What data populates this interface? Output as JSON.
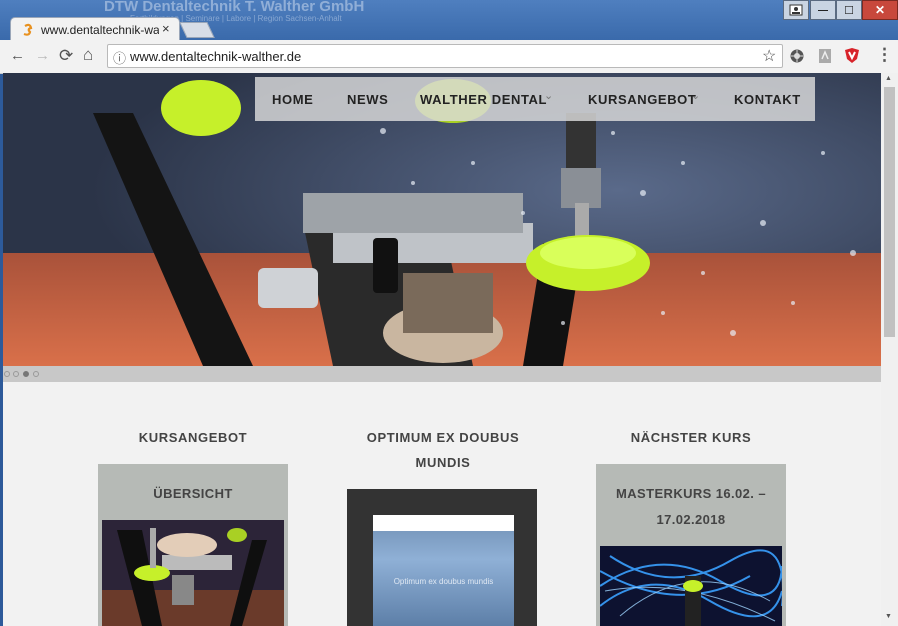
{
  "background_window": {
    "title": "DTW Dentaltechnik T. Walther GmbH",
    "subtitle": "Fortbildungen | Seminare | Labore | Region Sachsen-Anhalt"
  },
  "window_controls": {
    "minimize": "—",
    "maximize": "☐",
    "close": "✕"
  },
  "tab": {
    "title": "www.dentaltechnik-walth",
    "close": "×"
  },
  "toolbar": {
    "back": "←",
    "forward": "→",
    "reload": "⟳",
    "home": "⌂",
    "star": "☆",
    "menu": "⋮"
  },
  "omnibox": {
    "url": "www.dentaltechnik-walther.de",
    "info": "ⓘ"
  },
  "nav": {
    "items": [
      "HOME",
      "NEWS",
      "WALTHER DENTAL",
      "KURSANGEBOT",
      "KONTAKT"
    ],
    "dropdown_marker": "⌄"
  },
  "slider": {
    "total_dots": 4,
    "active_index": 2
  },
  "columns": [
    {
      "title": "KURSANGEBOT",
      "card_title": "ÜBERSICHT"
    },
    {
      "title_line1": "OPTIMUM EX DOUBUS",
      "title_line2": "MUNDIS",
      "video_caption": "Optimum ex doubus mundis"
    },
    {
      "title": "NÄCHSTER KURS",
      "card_line1": "MASTERKURS 16.02. –",
      "card_line2": "17.02.2018"
    }
  ],
  "colors": {
    "lime": "#c6f02a",
    "nav_bg": "#dcdcdc",
    "card_bg": "#b6bab6"
  },
  "scrollbar": {
    "up": "▲",
    "down": "▼"
  }
}
